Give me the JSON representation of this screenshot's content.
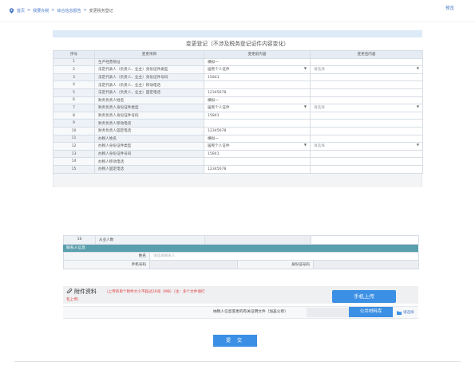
{
  "breadcrumb": {
    "home": "首页",
    "sep": ">",
    "level1": "我要办税",
    "level2": "综合信息报告",
    "current": "变更税务登记"
  },
  "preview_label": "预览",
  "form": {
    "title": "变更登记（不涉及税务登记证件内容变化）",
    "headers": [
      "序号",
      "变更项目",
      "变更前内容",
      "变更后内容"
    ],
    "rows": [
      {
        "no": "1",
        "item": "生产经营地址",
        "before": "横拟一",
        "before_select": false,
        "after_select": false,
        "after": ""
      },
      {
        "no": "2",
        "item": "法定代表人（负责人、业主）身份证件类型",
        "before": "居民个人证件",
        "before_select": true,
        "after_select": true,
        "after": "请选择"
      },
      {
        "no": "3",
        "item": "法定代表人（负责人、业主）身份证件号码",
        "before": "15841",
        "before_select": false,
        "after_select": false,
        "after": ""
      },
      {
        "no": "4",
        "item": "法定代表人（负责人、业主）移动电话",
        "before": "",
        "before_select": false,
        "after_select": false,
        "after": ""
      },
      {
        "no": "5",
        "item": "法定代表人（负责人、业主）固定电话",
        "before": "12345678",
        "before_select": false,
        "after_select": false,
        "after": ""
      },
      {
        "no": "6",
        "item": "财务负责人姓名",
        "before": "横拟一",
        "before_select": false,
        "after_select": false,
        "after": ""
      },
      {
        "no": "7",
        "item": "财务负责人身份证件类型",
        "before": "居民个人证件",
        "before_select": true,
        "after_select": true,
        "after": "请选择"
      },
      {
        "no": "8",
        "item": "财务负责人身份证件号码",
        "before": "15841",
        "before_select": false,
        "after_select": false,
        "after": ""
      },
      {
        "no": "9",
        "item": "财务负责人移动电话",
        "before": "",
        "before_select": false,
        "after_select": false,
        "after": ""
      },
      {
        "no": "10",
        "item": "财务负责人固定电话",
        "before": "12345678",
        "before_select": false,
        "after_select": false,
        "after": ""
      },
      {
        "no": "11",
        "item": "办税人姓名",
        "before": "横拟一",
        "before_select": false,
        "after_select": false,
        "after": ""
      },
      {
        "no": "12",
        "item": "办税人身份证件类型",
        "before": "居民个人证件",
        "before_select": true,
        "after_select": true,
        "after": "请选择"
      },
      {
        "no": "13",
        "item": "办税人身份证件号码",
        "before": "15841",
        "before_select": false,
        "after_select": false,
        "after": ""
      },
      {
        "no": "14",
        "item": "办税人移动电话",
        "before": "",
        "before_select": false,
        "after_select": false,
        "after": ""
      },
      {
        "no": "15",
        "item": "办税人固定电话",
        "before": "12345678",
        "before_select": false,
        "after_select": false,
        "after": ""
      }
    ]
  },
  "row16": {
    "no": "16",
    "item": "从业人数"
  },
  "contact": {
    "header": "联系人信息",
    "name_label": "姓名",
    "name_placeholder": "请选择联系人",
    "phone_label": "手机号码",
    "id_label": "身份证号码"
  },
  "attachments": {
    "title": "附件资料",
    "note": "（上传的单个附件大小不超过20兆（MB）（注：多个文件请打",
    "note2": "包上传）",
    "upload_button": "手机上传",
    "proof_label": "纳税人信息变更的有关证明文件（加盖公章）",
    "public_button": "公共材料库",
    "choose_file": "请选择"
  },
  "submit_label": "提 交",
  "colors": {
    "accent": "#3b8fe4",
    "contact_header": "#5a9fad",
    "note_red": "#e23d3d"
  }
}
